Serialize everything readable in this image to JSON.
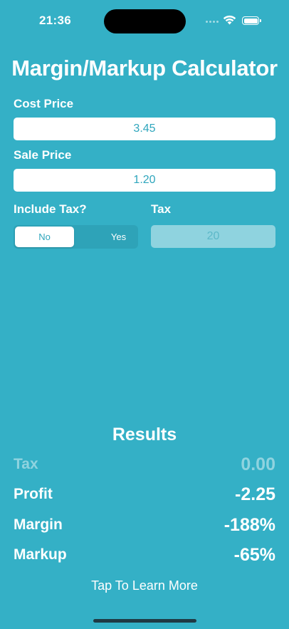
{
  "status_bar": {
    "time": "21:36"
  },
  "title": "Margin/Markup Calculator",
  "cost_price": {
    "label": "Cost Price",
    "value": "3.45"
  },
  "sale_price": {
    "label": "Sale Price",
    "value": "1.20"
  },
  "include_tax": {
    "label": "Include Tax?",
    "options": [
      "No",
      "Yes"
    ],
    "selected": "No"
  },
  "tax": {
    "label": "Tax",
    "value": "20"
  },
  "results": {
    "title": "Results",
    "rows": [
      {
        "label": "Tax",
        "value": "0.00"
      },
      {
        "label": "Profit",
        "value": "-2.25"
      },
      {
        "label": "Margin",
        "value": "-188%"
      },
      {
        "label": "Markup",
        "value": "-65%"
      }
    ]
  },
  "learn_more": "Tap To Learn More",
  "colors": {
    "background": "#34b0c6",
    "accent_text": "#2fa6bd",
    "dimmed": "#8fd3df"
  }
}
